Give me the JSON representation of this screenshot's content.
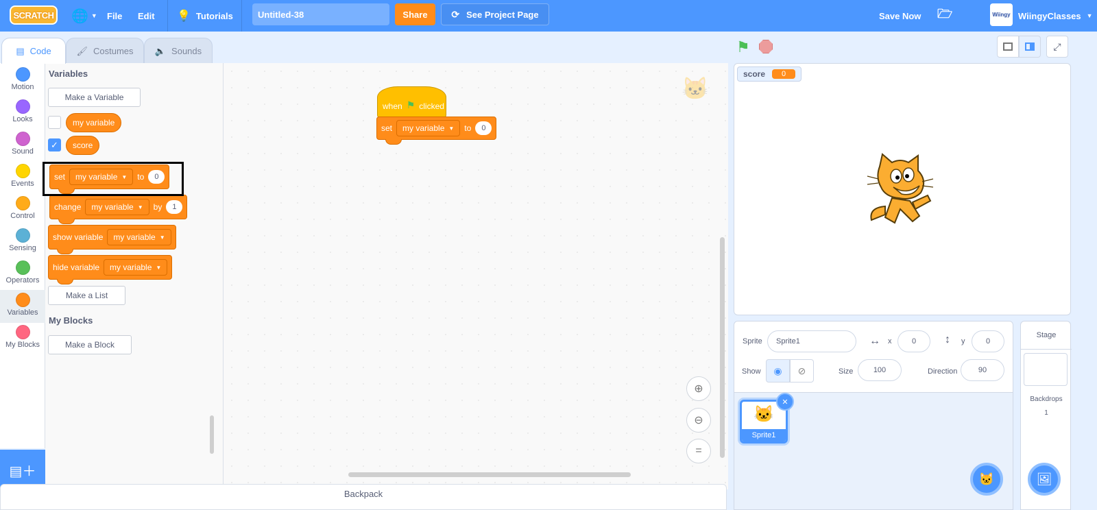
{
  "menubar": {
    "logo": "SCRATCH",
    "file": "File",
    "edit": "Edit",
    "tutorials": "Tutorials",
    "project_title": "Untitled-38",
    "share": "Share",
    "see_project_page": "See Project Page",
    "save_now": "Save Now",
    "username": "WiingyClasses",
    "avatar_text": "Wiingy"
  },
  "tabs": [
    {
      "label": "Code",
      "active": true
    },
    {
      "label": "Costumes",
      "active": false
    },
    {
      "label": "Sounds",
      "active": false
    }
  ],
  "categories": [
    {
      "label": "Motion",
      "color": "#4c97ff"
    },
    {
      "label": "Looks",
      "color": "#9966ff"
    },
    {
      "label": "Sound",
      "color": "#cf63cf"
    },
    {
      "label": "Events",
      "color": "#ffd500"
    },
    {
      "label": "Control",
      "color": "#ffab19"
    },
    {
      "label": "Sensing",
      "color": "#5cb1d6"
    },
    {
      "label": "Operators",
      "color": "#59c059"
    },
    {
      "label": "Variables",
      "color": "#ff8c1a"
    },
    {
      "label": "My Blocks",
      "color": "#ff6680"
    }
  ],
  "palette": {
    "variables_heading": "Variables",
    "make_variable": "Make a Variable",
    "vars": [
      {
        "name": "my variable",
        "checked": false
      },
      {
        "name": "score",
        "checked": true
      }
    ],
    "blocks": {
      "set": {
        "label": "set",
        "var": "my variable",
        "to": "to",
        "value": "0"
      },
      "change": {
        "label": "change",
        "var": "my variable",
        "by": "by",
        "value": "1"
      },
      "show": {
        "label": "show variable",
        "var": "my variable"
      },
      "hide": {
        "label": "hide variable",
        "var": "my variable"
      }
    },
    "make_list": "Make a List",
    "myblocks_heading": "My Blocks",
    "make_block": "Make a Block"
  },
  "script": {
    "hat": {
      "when": "when",
      "clicked": "clicked"
    },
    "set": {
      "label": "set",
      "var": "my variable",
      "to": "to",
      "value": "0"
    }
  },
  "backpack": "Backpack",
  "stage": {
    "monitor_label": "score",
    "monitor_value": "0"
  },
  "sprite_info": {
    "sprite_label": "Sprite",
    "sprite_name": "Sprite1",
    "x_label": "x",
    "x": "0",
    "y_label": "y",
    "y": "0",
    "show_label": "Show",
    "size_label": "Size",
    "size": "100",
    "direction_label": "Direction",
    "direction": "90"
  },
  "sprites": [
    {
      "name": "Sprite1",
      "selected": true
    }
  ],
  "stage_pane": {
    "title": "Stage",
    "backdrops_label": "Backdrops",
    "backdrops_count": "1"
  }
}
